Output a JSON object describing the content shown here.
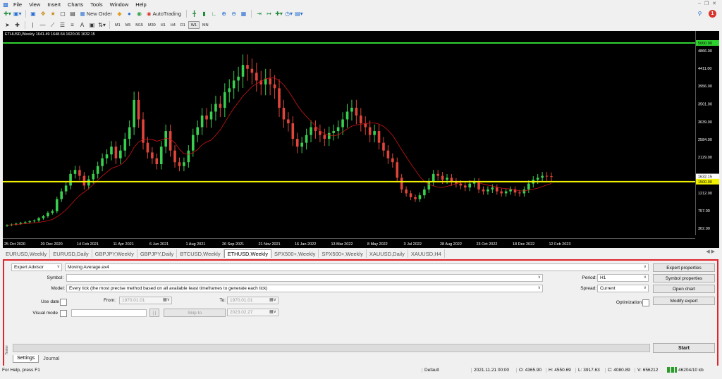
{
  "menu": [
    "File",
    "View",
    "Insert",
    "Charts",
    "Tools",
    "Window",
    "Help"
  ],
  "toolbar": {
    "new_order_label": "New Order",
    "autotrading_label": "AutoTrading",
    "timeframes": [
      "M1",
      "M5",
      "M15",
      "M30",
      "H1",
      "H4",
      "D1",
      "W1",
      "MN"
    ],
    "active_timeframe": "W1",
    "notification_count": "1"
  },
  "chart": {
    "info": "ETHUSD,Weekly  1641.49 1648.64 1620.06 1632.15",
    "price_labels": [
      "4866.00",
      "4411.00",
      "3956.00",
      "3501.00",
      "3039.00",
      "2584.00",
      "2129.00",
      "1212.00",
      "757.00",
      "302.00"
    ],
    "top_line_label": "5000.00",
    "current_price_label": "1632.15",
    "bottom_line_label": "1500.00",
    "date_labels": [
      "25 Oct 2020",
      "20 Dec 2020",
      "14 Feb 2021",
      "11 Apr 2021",
      "6 Jun 2021",
      "1 Aug 2021",
      "26 Sep 2021",
      "21 Nov 2021",
      "16 Jan 2022",
      "13 Mar 2022",
      "8 May 2022",
      "3 Jul 2022",
      "28 Aug 2022",
      "23 Oct 2022",
      "18 Dec 2022",
      "12 Feb 2023"
    ],
    "colors": {
      "bull": "#39d04f",
      "bear": "#e0453a",
      "ma": "#d01414",
      "top_line": "#2fd12f",
      "bottom_line": "#f2f200"
    }
  },
  "chart_tabs": [
    "EURUSD,Weekly",
    "EURUSD,Daily",
    "GBPJPY,Weekly",
    "GBPJPY,Daily",
    "BTCUSD,Weekly",
    "ETHUSD,Weekly",
    "SPX500+,Weekly",
    "SPX500+,Weekly",
    "XAUUSD,Daily",
    "XAUUSD,H4"
  ],
  "active_chart_tab": "ETHUSD,Weekly",
  "tester": {
    "side_label": "Tester",
    "type_value": "Expert Advisor",
    "expert_value": "Moving Average.ex4",
    "symbol_label": "Symbol:",
    "symbol_value": "",
    "model_label": "Model:",
    "model_value": "Every tick (the most precise method based on all available least timeframes to generate each tick)",
    "use_date_label": "Use date",
    "from_label": "From:",
    "from_value": "1970.01.01",
    "to_label": "To:",
    "to_value": "1970.01.01",
    "visual_mode_label": "Visual mode",
    "pause_label": "| |",
    "skip_to_label": "Skip to",
    "skip_to_value": "2023.02.27",
    "period_label": "Period:",
    "period_value": "H1",
    "spread_label": "Spread:",
    "spread_value": "Current",
    "optimization_label": "Optimization",
    "expert_properties_label": "Expert properties",
    "symbol_properties_label": "Symbol properties",
    "open_chart_label": "Open chart",
    "modify_expert_label": "Modify expert",
    "start_label": "Start",
    "tabs": [
      "Settings",
      "Journal"
    ],
    "active_tab": "Settings"
  },
  "status": {
    "help": "For Help, press F1",
    "profile": "Default",
    "datetime": "2021.11.21 00:00",
    "open": "O: 4365.90",
    "high": "H: 4550.69",
    "low": "L: 3917.63",
    "close": "C: 4080.89",
    "volume": "V: 656212",
    "traffic": "46204/10 kb"
  }
}
